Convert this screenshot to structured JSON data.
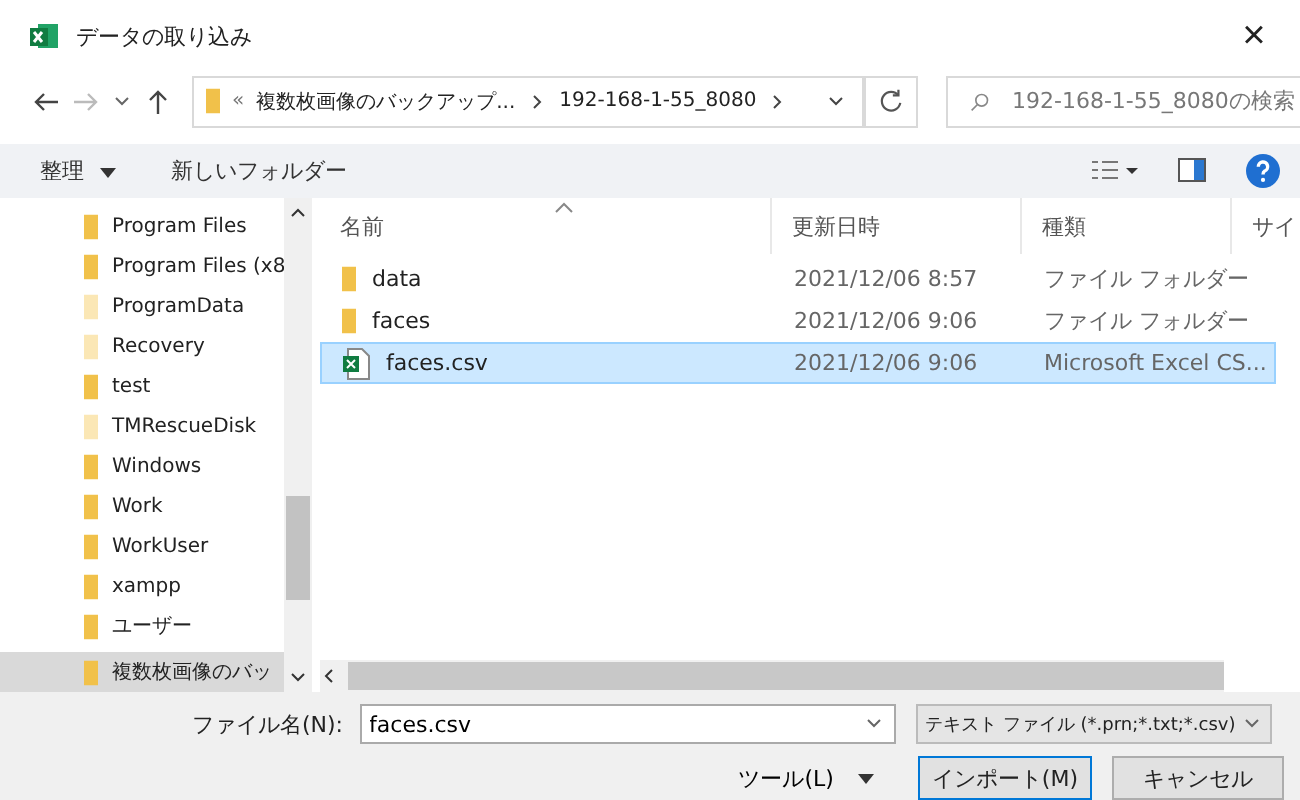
{
  "window": {
    "title": "データの取り込み",
    "close": "×"
  },
  "address": {
    "overflow": "«",
    "crumbs": [
      "複数枚画像のバックアップ...",
      "192-168-1-55_8080"
    ]
  },
  "search": {
    "placeholder": "192-168-1-55_8080の検索"
  },
  "toolbar": {
    "organize": "整理",
    "new_folder": "新しいフォルダー"
  },
  "sidebar": {
    "items": [
      {
        "label": "Program Files",
        "hidden": false,
        "selected": false
      },
      {
        "label": "Program Files (x8",
        "hidden": false,
        "selected": false
      },
      {
        "label": "ProgramData",
        "hidden": true,
        "selected": false
      },
      {
        "label": "Recovery",
        "hidden": true,
        "selected": false
      },
      {
        "label": "test",
        "hidden": false,
        "selected": false
      },
      {
        "label": "TMRescueDisk",
        "hidden": true,
        "selected": false
      },
      {
        "label": "Windows",
        "hidden": false,
        "selected": false
      },
      {
        "label": "Work",
        "hidden": false,
        "selected": false
      },
      {
        "label": "WorkUser",
        "hidden": false,
        "selected": false
      },
      {
        "label": "xampp",
        "hidden": false,
        "selected": false
      },
      {
        "label": "ユーザー",
        "hidden": false,
        "selected": false
      },
      {
        "label": "複数枚画像のバッ",
        "hidden": false,
        "selected": true
      }
    ]
  },
  "table": {
    "columns": [
      "名前",
      "更新日時",
      "種類",
      "サイ"
    ],
    "rows": [
      {
        "kind": "folder",
        "name": "data",
        "date": "2021/12/06 8:57",
        "type": "ファイル フォルダー",
        "selected": false
      },
      {
        "kind": "folder",
        "name": "faces",
        "date": "2021/12/06 9:06",
        "type": "ファイル フォルダー",
        "selected": false
      },
      {
        "kind": "csv",
        "name": "faces.csv",
        "date": "2021/12/06 9:06",
        "type": "Microsoft Excel CS...",
        "selected": true
      }
    ]
  },
  "footer": {
    "filename_label": "ファイル名(N):",
    "filename": "faces.csv",
    "filter": "テキスト ファイル (*.prn;*.txt;*.csv)",
    "tools": "ツール(L)",
    "import": "インポート(M)",
    "cancel": "キャンセル"
  }
}
